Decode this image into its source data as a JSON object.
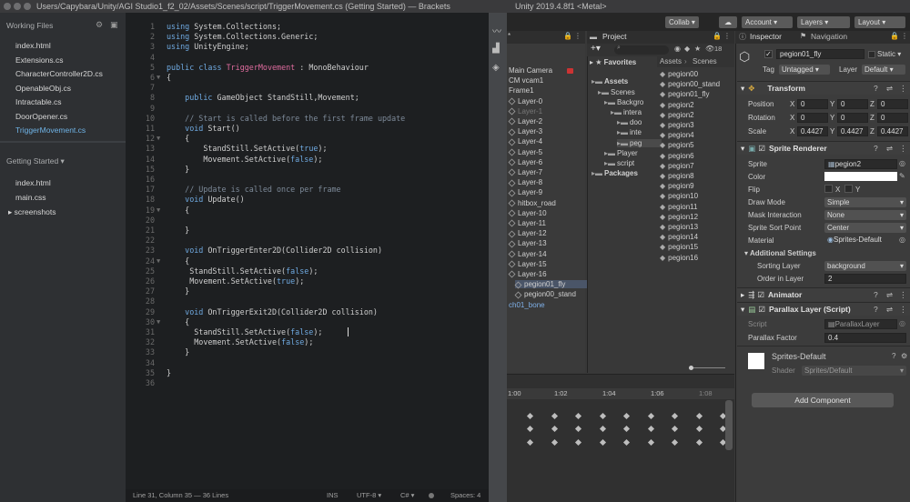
{
  "window": {
    "title": "Users/Capybara/Unity/AGI Studio1_f2_02/Assets/Scenes/script/TriggerMovement.cs (Getting Started) — Brackets",
    "unity_title": "Unity 2019.4.8f1 <Metal>"
  },
  "sidebar": {
    "working_files_label": "Working Files",
    "working_files": [
      "index.html",
      "Extensions.cs",
      "CharacterController2D.cs",
      "OpenableObj.cs",
      "Intractable.cs",
      "DoorOpener.cs",
      "TriggerMovement.cs"
    ],
    "project_label": "Getting Started ▾",
    "project_files": [
      "index.html",
      "main.css"
    ],
    "project_folder": "screenshots"
  },
  "editor": {
    "line_numbers": [
      "1",
      "2",
      "3",
      "4",
      "5",
      "6",
      "7",
      "8",
      "9",
      "10",
      "11",
      "12",
      "13",
      "14",
      "15",
      "16",
      "17",
      "18",
      "19",
      "20",
      "21",
      "22",
      "23",
      "24",
      "25",
      "26",
      "27",
      "28",
      "29",
      "30",
      "31",
      "32",
      "33",
      "34",
      "35",
      "36"
    ],
    "lines": [
      "using System.Collections;",
      "using System.Collections.Generic;",
      "using UnityEngine;",
      "",
      "public class TriggerMovement : MonoBehaviour",
      "{",
      "",
      "    public GameObject StandStill,Movement;",
      "",
      "    // Start is called before the first frame update",
      "    void Start()",
      "    {",
      "        StandStill.SetActive(true);",
      "        Movement.SetActive(false);",
      "    }",
      "",
      "    // Update is called once per frame",
      "    void Update()",
      "    {",
      "",
      "    }",
      "",
      "    void OnTriggerEnter2D(Collider2D collision)",
      "    {",
      "     StandStill.SetActive(false);",
      "     Movement.SetActive(true);",
      "    }",
      "",
      "    void OnTriggerExit2D(Collider2D collision)",
      "    {",
      "      StandStill.SetActive(false);",
      "      Movement.SetActive(false);",
      "    }",
      "",
      "}",
      ""
    ],
    "status": {
      "position": "Line 31, Column 35 — 36 Lines",
      "mode": "INS",
      "encoding": "UTF-8 ▾",
      "language": "C# ▾",
      "spaces": "Spaces: 4"
    }
  },
  "unity": {
    "toolbar": {
      "collab": "Collab ▾",
      "account": "Account ▾",
      "layers": "Layers ▾",
      "layout": "Layout ▾"
    },
    "hierarchy": {
      "items": [
        "Main Camera",
        "CM vcam1",
        "Frame1",
        "Layer-0",
        "Layer-1",
        "Layer-2",
        "Layer-3",
        "Layer-4",
        "Layer-5",
        "Layer-6",
        "Layer-7",
        "Layer-8",
        "Layer-9",
        "hitbox_road",
        "Layer-10",
        "Layer-11",
        "Layer-12",
        "Layer-13",
        "Layer-14",
        "Layer-15",
        "Layer-16",
        "pegion01_fly",
        "pegion00_stand",
        "ch01_bone"
      ]
    },
    "project": {
      "tab": "Project",
      "favorites": "Favorites",
      "tree": [
        "Assets",
        "Scenes",
        "Backgro",
        "intera",
        "doo",
        "inte",
        "peg",
        "Player",
        "script",
        "Packages"
      ],
      "breadcrumb": [
        "Assets",
        "Scenes"
      ],
      "files": [
        "pegion00",
        "pegion00_stand",
        "pegion01_fly",
        "pegion2",
        "pegion2",
        "pegion3",
        "pegion4",
        "pegion5",
        "pegion6",
        "pegion7",
        "pegion8",
        "pegion9",
        "pegion10",
        "pegion11",
        "pegion12",
        "pegion13",
        "pegion14",
        "pegion15",
        "pegion16"
      ],
      "count": "18"
    },
    "timeline": {
      "ticks": [
        "1:00",
        "1:02",
        "1:04",
        "1:06",
        "1:08"
      ]
    },
    "inspector": {
      "tabs": [
        "Inspector",
        "Navigation"
      ],
      "object_name": "pegion01_fly",
      "static_label": "Static ▾",
      "tag_label": "Tag",
      "tag_value": "Untagged",
      "layer_label": "Layer",
      "layer_value": "Default",
      "transform": {
        "title": "Transform",
        "position": {
          "label": "Position",
          "x": "0",
          "y": "0",
          "z": "0"
        },
        "rotation": {
          "label": "Rotation",
          "x": "0",
          "y": "0",
          "z": "0"
        },
        "scale": {
          "label": "Scale",
          "x": "0.4427",
          "y": "0.4427",
          "z": "0.4427"
        }
      },
      "sprite_renderer": {
        "title": "Sprite Renderer",
        "sprite": {
          "label": "Sprite",
          "value": "pegion2"
        },
        "color_label": "Color",
        "flip": {
          "label": "Flip",
          "x": "X",
          "y": "Y"
        },
        "draw_mode": {
          "label": "Draw Mode",
          "value": "Simple"
        },
        "mask": {
          "label": "Mask Interaction",
          "value": "None"
        },
        "sort_point": {
          "label": "Sprite Sort Point",
          "value": "Center"
        },
        "material": {
          "label": "Material",
          "value": "Sprites-Default"
        },
        "additional": "Additional Settings",
        "sorting_layer": {
          "label": "Sorting Layer",
          "value": "background"
        },
        "order": {
          "label": "Order in Layer",
          "value": "2"
        }
      },
      "animator": {
        "title": "Animator"
      },
      "parallax": {
        "title": "Parallax Layer (Script)",
        "script": {
          "label": "Script",
          "value": "ParallaxLayer"
        },
        "factor": {
          "label": "Parallax Factor",
          "value": "0.4"
        }
      },
      "material_block": {
        "name": "Sprites-Default",
        "shader_label": "Shader",
        "shader_value": "Sprites/Default"
      },
      "add_component": "Add Component"
    }
  }
}
